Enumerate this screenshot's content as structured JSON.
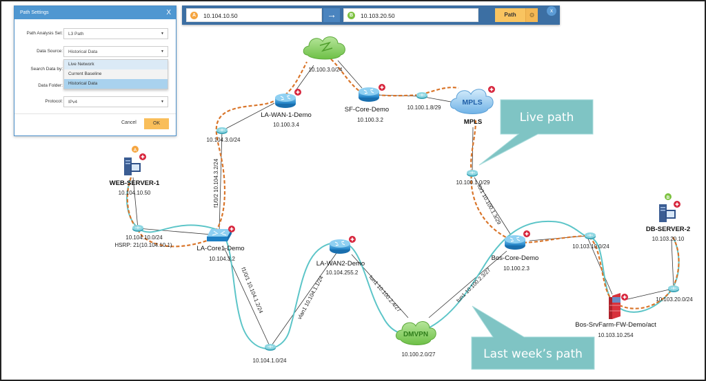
{
  "dialog": {
    "title": "Path Settings",
    "close_label": "X",
    "fields": [
      {
        "label": "Path Analysis Set:",
        "value": "L3 Path"
      },
      {
        "label": "Data Source:",
        "value": "Historical Data"
      },
      {
        "label": "Search Data by:",
        "value": ""
      },
      {
        "label": "Data Folder:",
        "value": ""
      },
      {
        "label": "Protocol:",
        "value": "IPv4"
      }
    ],
    "data_source_options": [
      "Live Network",
      "Current Baseline",
      "Historical Data"
    ],
    "cancel_label": "Cancel",
    "ok_label": "OK"
  },
  "pathbar": {
    "source_badge": "A",
    "source_ip": "10.104.10.50",
    "arrow": "→",
    "dest_badge": "B",
    "dest_ip": "10.103.20.50",
    "path_label": "Path",
    "gear": "⚙",
    "close": "x"
  },
  "colors": {
    "live_path": "#d9752a",
    "last_week_path": "#5cc5c8",
    "callout": "#7fc4c4",
    "badge_a": "#f5a540",
    "badge_b": "#7dc241",
    "accent": "#f9c460"
  },
  "callouts": {
    "live": "Live path",
    "last_week": "Last week’s path"
  },
  "nodes": {
    "web_server": {
      "name": "WEB-SERVER-1",
      "ip": "10.104.10.50",
      "badge": "A"
    },
    "db_server": {
      "name": "DB-SERVER-2",
      "ip": "10.103.20.10",
      "badge": "B"
    },
    "la_core": {
      "name": "LA-Core1-Demo",
      "ip": "10.104.3.2"
    },
    "la_wan1": {
      "name": "LA-WAN-1-Demo",
      "ip": "10.100.3.4"
    },
    "la_wan2": {
      "name": "LA-WAN2-Demo",
      "ip": "10.104.255.2"
    },
    "sf_core": {
      "name": "SF-Core-Demo",
      "ip": "10.100.3.2"
    },
    "bos_core": {
      "name": "Bos-Core-Demo",
      "ip": "10.100.2.3"
    },
    "bos_fw": {
      "name": "Bos-SrvFarm-FW-Demo/act",
      "ip": "10.103.10.254"
    },
    "mpls": {
      "name": "MPLS",
      "label": "MPLS"
    },
    "dmvpn": {
      "label": "DMVPN",
      "subnet": "10.100.2.0/27"
    },
    "frame_cloud": {
      "subnet": "10.100.3.0/24"
    }
  },
  "subnets": {
    "s1": "10.104.10.0/24",
    "s1_hsrp": "HSRP: 21(10.104.10.1)",
    "s2": "10.104.3.0/24",
    "s3": "10.100.1.8/29",
    "s4": "10.100.1.0/29",
    "s5": "10.104.1.0/24",
    "s6": "10.103.10.0/24",
    "s7": "10.103.20.0/24"
  },
  "links": {
    "l1": "f1/0/2 10.104.3.2/24",
    "l2": "f1/0/1 10.104.1.2/24",
    "l3": "vlan1 10.104.1.1/24",
    "l4": "tun1 10.100.2.4/27",
    "l5": "tun1 10.100.2.3/27",
    "l6": "f0/1 10.100.1.3/29"
  }
}
